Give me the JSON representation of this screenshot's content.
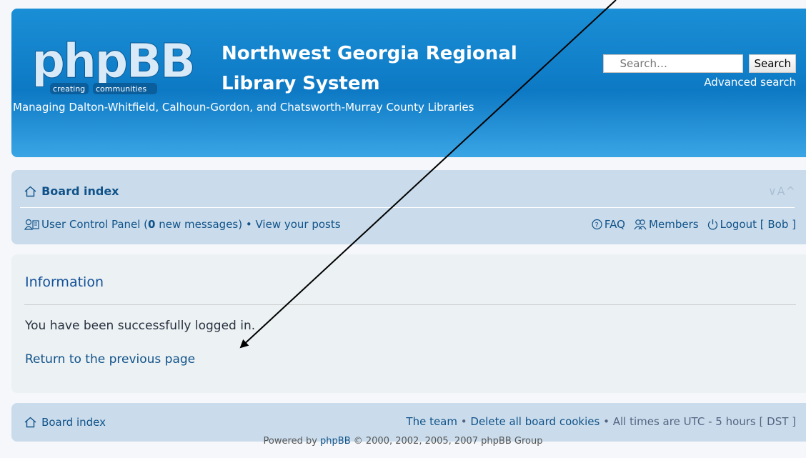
{
  "header": {
    "logo_text": "phpBB",
    "logo_tagline": "creating communities",
    "site_title_line1": "Northwest Georgia Regional",
    "site_title_line2": "Library System",
    "site_description": "Managing Dalton-Whitfield, Calhoun-Gordon, and Chatsworth-Murray County Libraries",
    "search_placeholder": "Search…",
    "search_button": "Search",
    "advanced_search": "Advanced search"
  },
  "navbar": {
    "breadcrumb": "Board index",
    "font_resize": "∨A^",
    "ucp_label": "User Control Panel (",
    "new_messages_count": "0",
    "new_messages_suffix": " new messages)",
    "separator": " • ",
    "view_posts": "View your posts",
    "faq": "FAQ",
    "members": "Members",
    "logout": "Logout [ Bob ]"
  },
  "panel": {
    "title": "Information",
    "message": "You have been successfully logged in.",
    "return_link": "Return to the previous page"
  },
  "footer": {
    "board_index": "Board index",
    "team": "The team",
    "delete_cookies": "Delete all board cookies",
    "timezone": "All times are UTC - 5 hours [ DST ]",
    "sep": " • ",
    "powered_prefix": "Powered by ",
    "powered_link": "phpBB",
    "powered_suffix": " © 2000, 2002, 2005, 2007 phpBB Group"
  },
  "colors": {
    "header_blue": "#0d79c4",
    "nav_bg": "#cadceb",
    "panel_bg": "#ecf1f3",
    "link": "#105289"
  },
  "icons": [
    "home-icon",
    "user-control-panel-icon",
    "faq-icon",
    "members-icon",
    "logout-icon",
    "search-icon"
  ]
}
